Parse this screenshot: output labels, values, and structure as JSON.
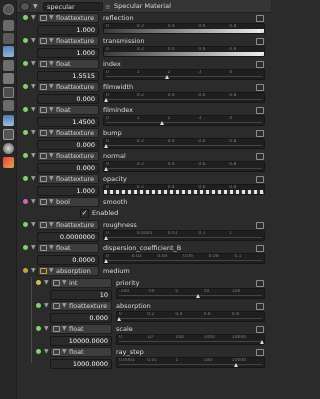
{
  "header": {
    "node_type": "specular",
    "title": "Specular Material"
  },
  "toolbar": {
    "icons": [
      "node-icon",
      "copy-icon",
      "paste-icon",
      "image-icon",
      "texture-icon",
      "node-group-icon",
      "graph-icon",
      "layers-icon",
      "image-icon",
      "material-icon",
      "shader-icon",
      "color-icon",
      "palette-icon"
    ]
  },
  "rows": [
    {
      "type": "floattexture",
      "label": "reflection",
      "value": "1.000",
      "ticks": [
        "0",
        "0.2",
        "0.4",
        "0.6",
        "0.8"
      ],
      "fill": 1.0
    },
    {
      "type": "floattexture",
      "label": "transmission",
      "value": "1.000",
      "ticks": [
        "0",
        "0.2",
        "0.4",
        "0.6",
        "0.8"
      ],
      "fill": 1.0
    },
    {
      "type": "float",
      "label": "index",
      "value": "1.5515",
      "ticks": [
        "0",
        "1",
        "2",
        "3",
        "4"
      ],
      "pos": 0.39
    },
    {
      "type": "floattexture",
      "label": "filmwidth",
      "value": "0.000",
      "ticks": [
        "0",
        "0.2",
        "0.4",
        "0.6",
        "0.8"
      ],
      "fill": 0.0
    },
    {
      "type": "float",
      "label": "filmindex",
      "value": "1.4500",
      "ticks": [
        "0",
        "1",
        "2",
        "3",
        "4"
      ],
      "pos": 0.36
    },
    {
      "type": "floattexture",
      "label": "bump",
      "value": "0.000",
      "ticks": [
        "0",
        "0.2",
        "0.4",
        "0.6",
        "0.8"
      ],
      "fill": 0.0
    },
    {
      "type": "floattexture",
      "label": "normal",
      "value": "0.000",
      "ticks": [
        "0",
        "0.2",
        "0.4",
        "0.6",
        "0.8"
      ],
      "fill": 0.0
    },
    {
      "type": "floattexture",
      "label": "opacity",
      "value": "1.000",
      "ticks": [
        "0",
        "0.2",
        "0.4",
        "0.6",
        "0.8"
      ],
      "fill": 1.0
    }
  ],
  "bool_row": {
    "type": "bool",
    "label": "smooth",
    "checkbox_label": "Enabled",
    "checked": true
  },
  "rows2": [
    {
      "type": "floattexture",
      "label": "roughness",
      "value": "0.0000000",
      "ticks": [
        "0",
        "0.0001",
        "0.01",
        "0.1",
        "1"
      ],
      "fill": 0.0
    },
    {
      "type": "float",
      "label": "dispersion_coefficient_B",
      "value": "0.0000",
      "ticks": [
        "0",
        "0.02",
        "0.04",
        "0.06",
        "0.08",
        "0.1"
      ],
      "pos": 0.0
    }
  ],
  "medium": {
    "type": "absorption",
    "label": "medium"
  },
  "medium_rows": [
    {
      "type": "int",
      "label": "priority",
      "value": "10",
      "ticks": [
        "-100",
        "-50",
        "0",
        "50",
        "100"
      ],
      "pos": 0.55
    },
    {
      "type": "floattexture",
      "label": "absorption",
      "value": "0.000",
      "ticks": [
        "0",
        "0.2",
        "0.4",
        "0.6",
        "0.8"
      ],
      "fill": 0.0
    },
    {
      "type": "float",
      "label": "scale",
      "value": "10000.0000",
      "ticks": [
        "0",
        "10",
        "100",
        "1000",
        "10000"
      ],
      "pos": 1.0
    },
    {
      "type": "float",
      "label": "ray_step",
      "value": "1000.0000",
      "ticks": [
        "0.0001",
        "0.01",
        "1",
        "100",
        "10000"
      ],
      "pos": 0.82
    }
  ],
  "colors": {
    "float_socket": "#7ed36a",
    "bool_socket": "#d067b4",
    "medium_socket": "#c9a040",
    "int_socket": "#d0c34a"
  }
}
